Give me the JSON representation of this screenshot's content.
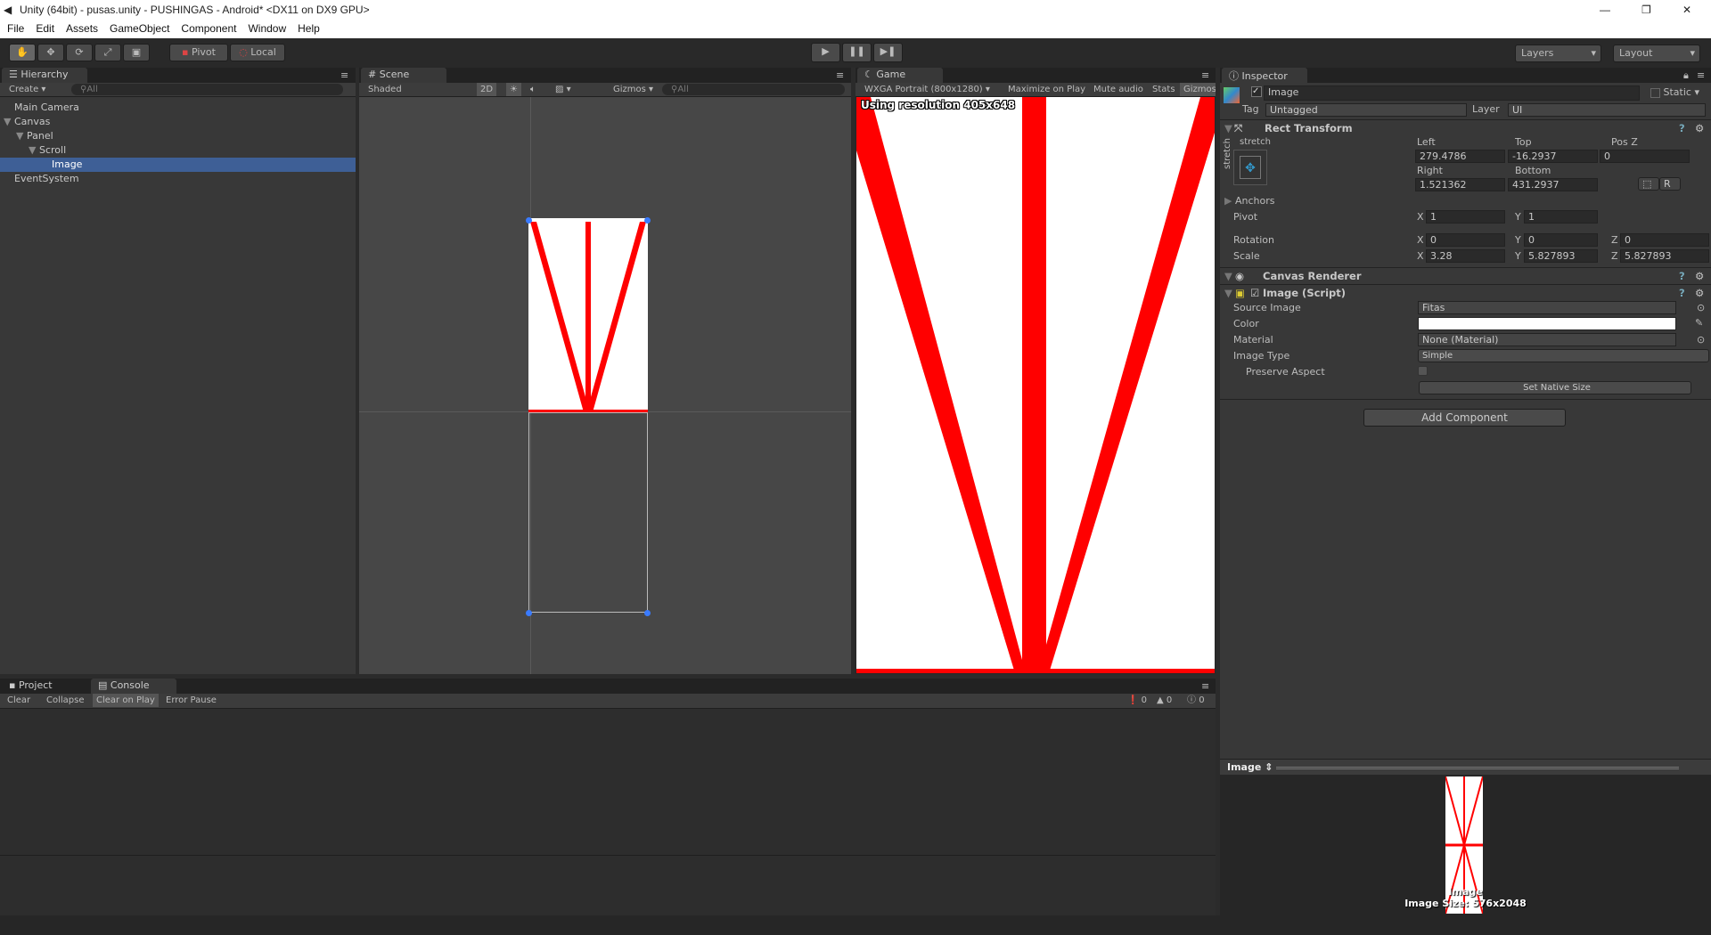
{
  "window": {
    "title": "Unity (64bit) - pusas.unity - PUSHINGAS - Android* <DX11 on DX9 GPU>"
  },
  "menu": [
    "File",
    "Edit",
    "Assets",
    "GameObject",
    "Component",
    "Window",
    "Help"
  ],
  "toolbar": {
    "pivot": "Pivot",
    "local": "Local",
    "layers": "Layers",
    "layout": "Layout"
  },
  "hierarchy": {
    "tab": "Hierarchy",
    "create": "Create",
    "search": "All",
    "items": [
      {
        "label": "Main Camera"
      },
      {
        "label": "Canvas"
      },
      {
        "label": "Panel"
      },
      {
        "label": "Scroll"
      },
      {
        "label": "Image",
        "selected": true
      },
      {
        "label": "EventSystem"
      }
    ]
  },
  "scene": {
    "tab": "Scene",
    "shading": "Shaded",
    "mode2d": "2D",
    "gizmos": "Gizmos",
    "search": "All"
  },
  "game": {
    "tab": "Game",
    "resolution": "WXGA Portrait (800x1280)",
    "maximize": "Maximize on Play",
    "mute": "Mute audio",
    "stats": "Stats",
    "gizmos": "Gizmos",
    "overlay": "Using resolution 405x648"
  },
  "inspector": {
    "tab": "Inspector",
    "name": "Image",
    "static": "Static",
    "tag_label": "Tag",
    "tag": "Untagged",
    "layer_label": "Layer",
    "layer": "UI",
    "rect": {
      "title": "Rect Transform",
      "stretch_h": "stretch",
      "stretch_v": "stretch",
      "left_label": "Left",
      "top_label": "Top",
      "posz_label": "Pos Z",
      "left": "279.4786",
      "top": "-16.2937",
      "posz": "0",
      "right_label": "Right",
      "bottom_label": "Bottom",
      "right": "1.521362",
      "bottom": "431.2937",
      "r_button": "R",
      "anchors": "Anchors",
      "pivot": "Pivot",
      "pivot_x": "1",
      "pivot_y": "1",
      "rotation": "Rotation",
      "rot_x": "0",
      "rot_y": "0",
      "rot_z": "0",
      "scale": "Scale",
      "scale_x": "3.28",
      "scale_y": "5.827893",
      "scale_z": "5.827893",
      "x": "X",
      "y": "Y",
      "z": "Z"
    },
    "canvas_renderer": "Canvas Renderer",
    "image": {
      "title": "Image (Script)",
      "source_label": "Source Image",
      "source": "Fitas",
      "color_label": "Color",
      "color": "#ffffff",
      "material_label": "Material",
      "material": "None (Material)",
      "type_label": "Image Type",
      "type": "Simple",
      "preserve_label": "Preserve Aspect",
      "native": "Set Native Size"
    },
    "add_component": "Add Component",
    "preview": {
      "title": "Image",
      "name": "Image",
      "size": "Image Size: 576x2048"
    }
  },
  "console": {
    "project_tab": "Project",
    "console_tab": "Console",
    "clear": "Clear",
    "collapse": "Collapse",
    "clear_on_play": "Clear on Play",
    "error_pause": "Error Pause",
    "errors": "0",
    "warnings": "0",
    "logs": "0"
  },
  "colors": {
    "selection": "#3e5f96",
    "stripe": "#ff0000",
    "bg": "#383838"
  }
}
